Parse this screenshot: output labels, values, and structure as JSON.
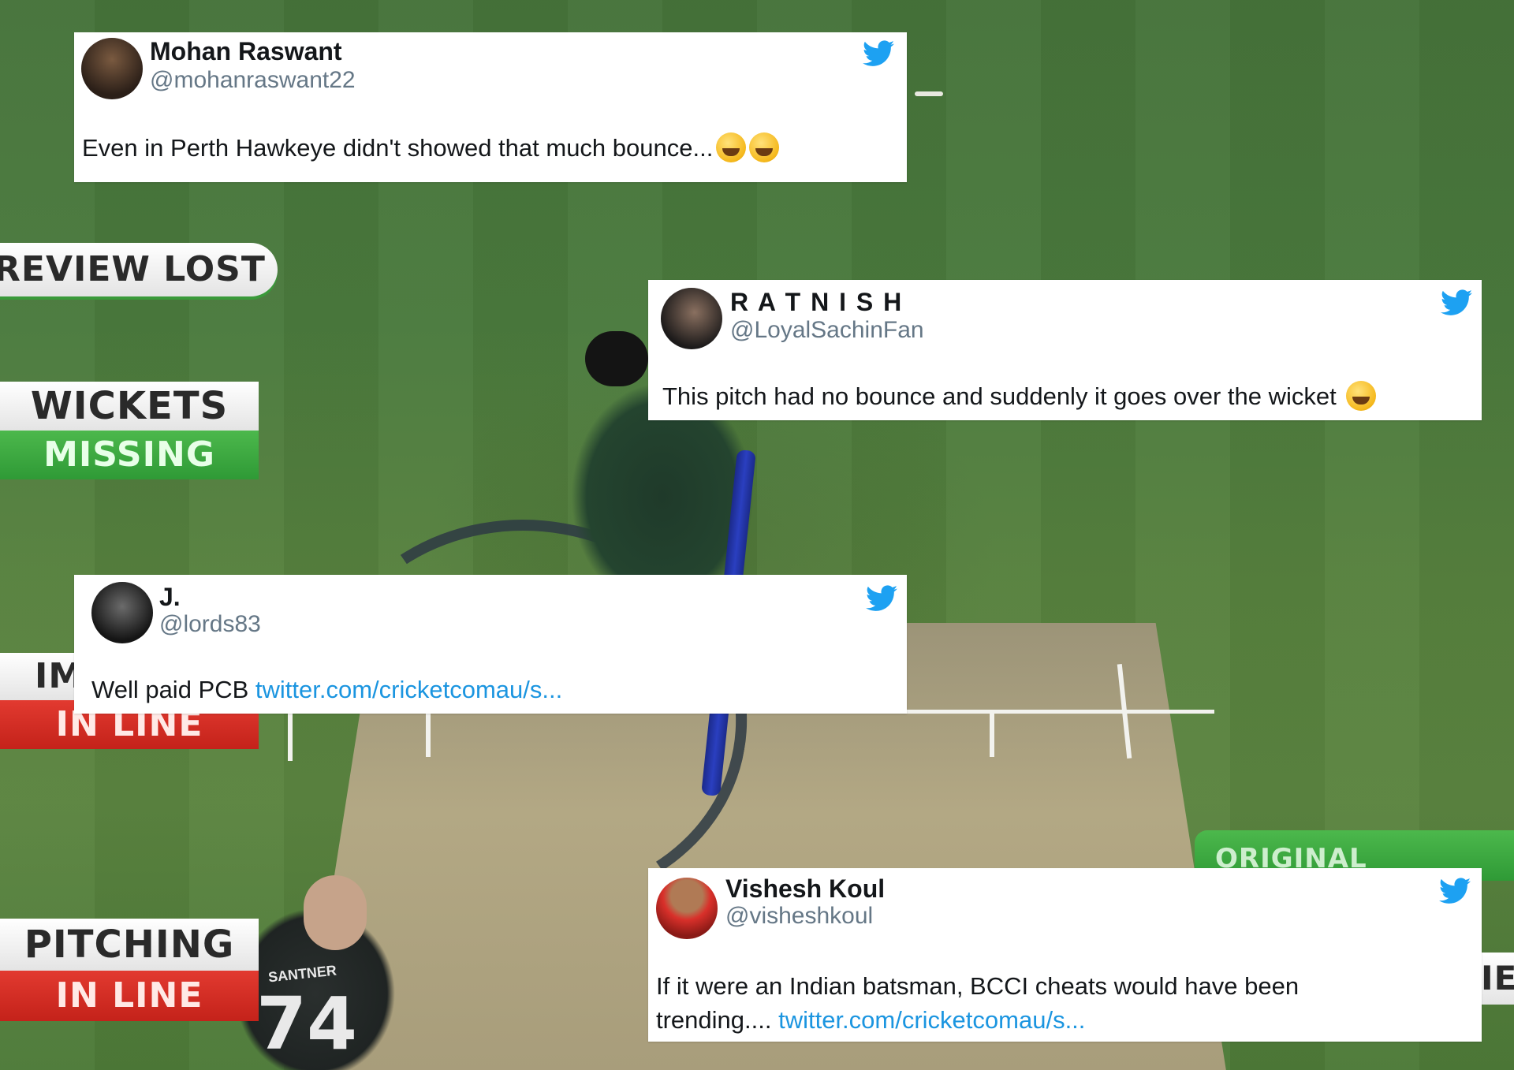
{
  "graphics": {
    "review_lost": "REVIEW LOST",
    "wickets": "WICKETS",
    "missing": "MISSING",
    "impact_partial": "IM",
    "in_line_1": "IN LINE",
    "pitching": "PITCHING",
    "in_line_2": "IN LINE",
    "original_decision": "ORIGINAL DECISION",
    "review_partial": "IEV",
    "jersey_name": "SANTNER",
    "jersey_number": "74"
  },
  "tweets": [
    {
      "name": "Mohan Raswant",
      "handle": "@mohanraswant22",
      "text": "Even in Perth Hawkeye didn't showed that much bounce...",
      "link": "",
      "emoji": "rolling-on-floor-laughing-icon ×2"
    },
    {
      "name": "R A T N I S H",
      "handle": "@LoyalSachinFan",
      "text": "This pitch had no bounce and suddenly it goes over the wicket",
      "link": "",
      "emoji": "tears-of-joy-icon"
    },
    {
      "name": "J.",
      "handle": "@lords83",
      "text": "Well paid PCB ",
      "link": "twitter.com/cricketcomau/s..."
    },
    {
      "name": "Vishesh Koul",
      "handle": "@visheshkoul",
      "text": "If it were an Indian batsman, BCCI cheats would have been trending.... ",
      "link": "twitter.com/cricketcomau/s..."
    }
  ],
  "colors": {
    "twitter_blue": "#1da1f2",
    "link_blue": "#1b95e0",
    "graphic_green": "#3aa83f",
    "graphic_red": "#d42c22"
  }
}
